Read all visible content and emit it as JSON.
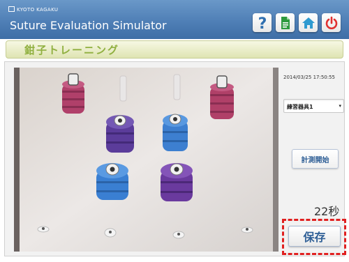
{
  "header": {
    "brand": "KYOTO KAGAKU",
    "app_title": "Suture Evaluation Simulator",
    "icons": [
      "help-icon",
      "report-icon",
      "home-icon",
      "power-icon"
    ]
  },
  "screen": {
    "title": "鉗子トレーニング"
  },
  "panel": {
    "timestamp": "2014/03/25 17:50:55",
    "device_select": {
      "value": "練習器具1",
      "arrow": "▾"
    },
    "measure_label": "計測開始",
    "elapsed": "22秒",
    "save_label": "保存"
  },
  "colors": {
    "header_blue": "#4f7fb6",
    "title_green": "#90b040",
    "button_text": "#2f5f96",
    "highlight_red": "#e02020"
  }
}
